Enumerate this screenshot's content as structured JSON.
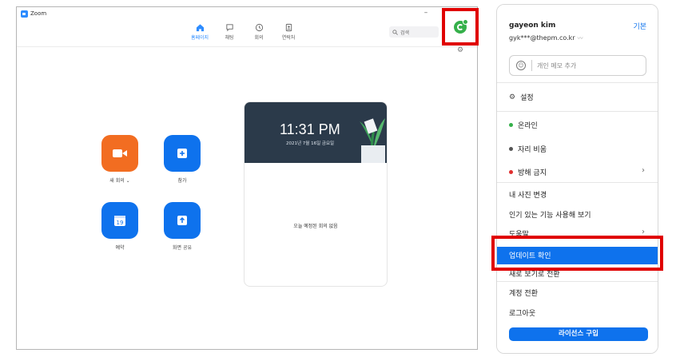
{
  "window": {
    "title": "Zoom",
    "min": "–",
    "max": "□",
    "close": "×"
  },
  "nav": [
    {
      "label": "홈페이지",
      "icon": "home-icon"
    },
    {
      "label": "채팅",
      "icon": "chat-icon"
    },
    {
      "label": "회의",
      "icon": "clock-icon"
    },
    {
      "label": "연락처",
      "icon": "contacts-icon"
    }
  ],
  "search": {
    "placeholder": "검색"
  },
  "actions": {
    "new_meeting": "새 회의 ⌄",
    "join": "참가",
    "schedule": "예약",
    "share": "화면 공유",
    "calendar_day": "19"
  },
  "card": {
    "time": "11:31 PM",
    "date": "2021년 7월 16일 금요일",
    "empty": "오늘 예정된 회의 없음"
  },
  "menu": {
    "name": "gayeon kim",
    "plan": "기본",
    "email": "gyk***@thepm.co.kr",
    "memo_placeholder": "개인 메모 추가",
    "settings": "설정",
    "online": "온라인",
    "away": "자리 비움",
    "dnd": "방해 금지",
    "change_photo": "내 사진 변경",
    "try_features": "인기 있는 기능 사용해 보기",
    "help": "도움말",
    "check_updates": "업데이트 확인",
    "new_view": "새로 보기로 전환",
    "switch_account": "계정 전환",
    "logout": "로그아웃",
    "buy_license": "라이선스 구입"
  },
  "colors": {
    "accent": "#0e72ed",
    "highlight": "#e00000",
    "online": "#35b04a",
    "dnd": "#e02f2f"
  }
}
